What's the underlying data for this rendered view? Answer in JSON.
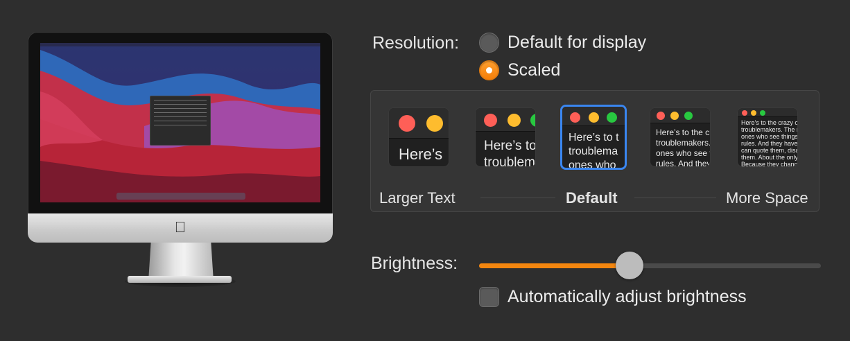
{
  "resolution": {
    "label": "Resolution:",
    "options": [
      {
        "label": "Default for display",
        "selected": false
      },
      {
        "label": "Scaled",
        "selected": true
      }
    ]
  },
  "scaling": {
    "thumbnails": [
      {
        "text": "Here’s"
      },
      {
        "text_line1": "Here’s to",
        "text_line2": "troublem"
      },
      {
        "text_line1": "Here’s to t",
        "text_line2": "troublema",
        "text_line3": "ones who",
        "selected": true
      },
      {
        "text_line1": "Here’s to the cr",
        "text_line2": "troublemakers.",
        "text_line3": "ones who see t",
        "text_line4": "rules. And they"
      },
      {
        "text_line1": "Here’s to the crazy one",
        "text_line2": "troublemakers. The rou",
        "text_line3": "ones who see things dif",
        "text_line4": "rules. And they have no",
        "text_line5": "can quote them, disagre",
        "text_line6": "them. About the only th",
        "text_line7": "Because they change th"
      }
    ],
    "left_label": "Larger Text",
    "center_label": "Default",
    "right_label": "More Space"
  },
  "brightness": {
    "label": "Brightness:",
    "level": 0.44
  },
  "auto_brightness": {
    "label": "Automatically adjust brightness",
    "checked": false
  },
  "colors": {
    "accent_orange": "#f3860f",
    "selection_blue": "#3a86f0"
  },
  "icons": [
    "apple-logo-icon"
  ]
}
